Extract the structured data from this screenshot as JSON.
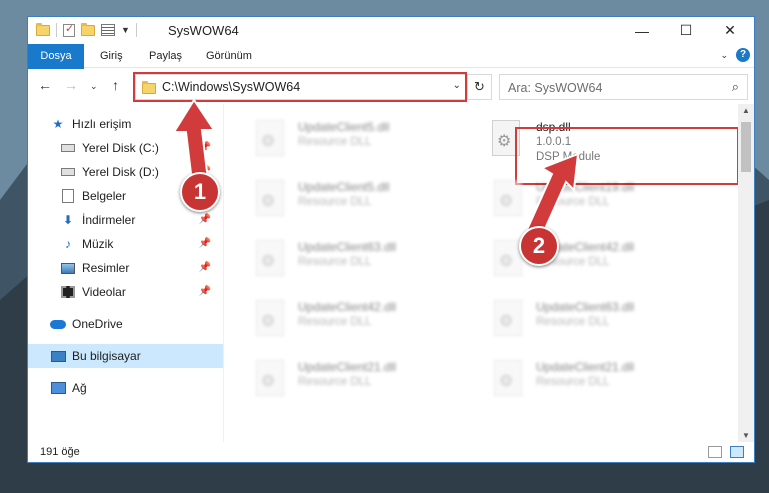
{
  "window": {
    "title": "SysWOW64"
  },
  "ribbon": {
    "tabs": [
      "Dosya",
      "Giriş",
      "Paylaş",
      "Görünüm"
    ]
  },
  "address": {
    "path": "C:\\Windows\\SysWOW64"
  },
  "search": {
    "placeholder": "Ara: SysWOW64"
  },
  "sidebar": {
    "items": [
      {
        "label": "Hızlı erişim",
        "icon": "star-icon"
      },
      {
        "label": "Yerel Disk (C:)",
        "icon": "drive-icon",
        "pinned": true
      },
      {
        "label": "Yerel Disk (D:)",
        "icon": "drive-icon",
        "pinned": true
      },
      {
        "label": "Belgeler",
        "icon": "documents-icon",
        "pinned": true
      },
      {
        "label": "İndirmeler",
        "icon": "downloads-icon",
        "pinned": true
      },
      {
        "label": "Müzik",
        "icon": "music-icon",
        "pinned": true
      },
      {
        "label": "Resimler",
        "icon": "pictures-icon",
        "pinned": true
      },
      {
        "label": "Videolar",
        "icon": "videos-icon",
        "pinned": true
      },
      {
        "label": "OneDrive",
        "icon": "onedrive-icon"
      },
      {
        "label": "Bu bilgisayar",
        "icon": "this-pc-icon",
        "selected": true
      },
      {
        "label": "Ağ",
        "icon": "network-icon"
      }
    ]
  },
  "files": {
    "highlighted": {
      "name": "dsp.dll",
      "version": "1.0.0.1",
      "description": "DSP Module"
    },
    "left": [
      {
        "name": "UpdateClient5.dll",
        "description": "Resource DLL"
      },
      {
        "name": "UpdateClient5.dll",
        "description": "Resource DLL"
      },
      {
        "name": "UpdateClient63.dll",
        "description": "Resource DLL"
      },
      {
        "name": "UpdateClient42.dll",
        "description": "Resource DLL"
      },
      {
        "name": "UpdateClient21.dll",
        "description": "Resource DLL"
      }
    ],
    "right": [
      {
        "name": "UpdateClient19.dll",
        "description": "Resource DLL"
      },
      {
        "name": "UpdateClient42.dll",
        "description": "Resource DLL"
      },
      {
        "name": "UpdateClient63.dll",
        "description": "Resource DLL"
      },
      {
        "name": "UpdateClient21.dll",
        "description": "Resource DLL"
      }
    ]
  },
  "status": {
    "count": "191 öğe"
  },
  "annotations": {
    "badge1": "1",
    "badge2": "2",
    "color": "#d23b3b"
  }
}
